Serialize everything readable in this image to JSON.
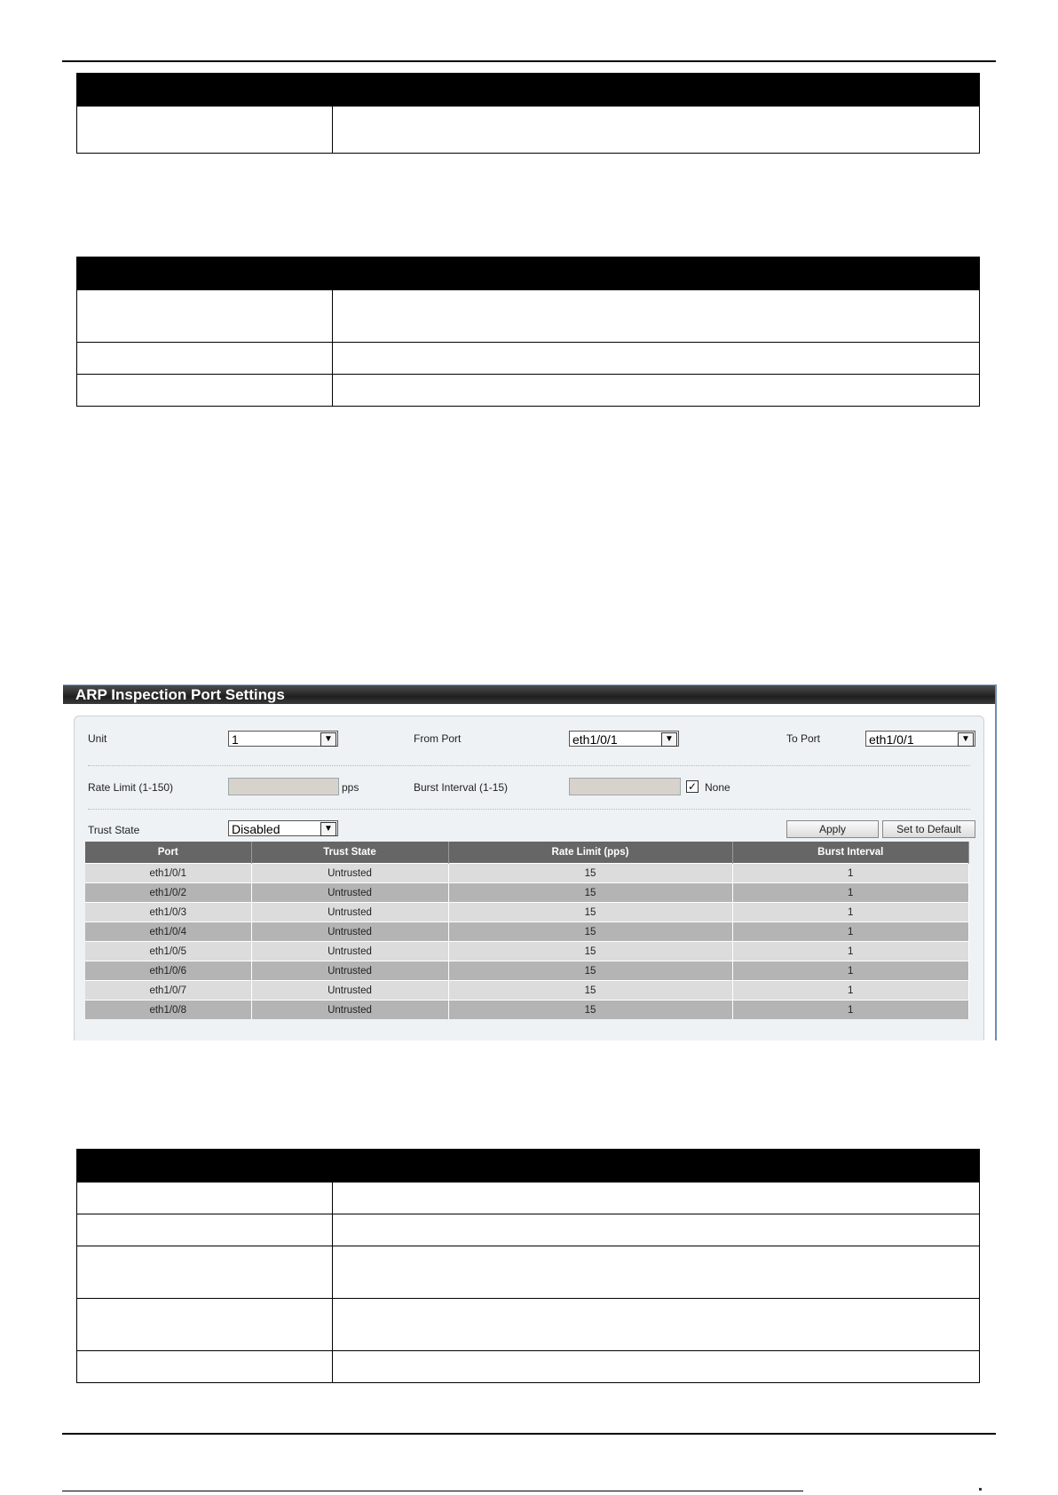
{
  "arp_panel": {
    "title": "ARP Inspection Port Settings",
    "unit_label": "Unit",
    "unit_value": "1",
    "from_port_label": "From Port",
    "from_port_value": "eth1/0/1",
    "to_port_label": "To Port",
    "to_port_value": "eth1/0/1",
    "rate_limit_label": "Rate Limit (1-150)",
    "rate_limit_unit": "pps",
    "burst_interval_label": "Burst Interval (1-15)",
    "none_label": "None",
    "none_checked": true,
    "trust_state_label": "Trust State",
    "trust_state_value": "Disabled",
    "apply_label": "Apply",
    "default_label": "Set to Default",
    "columns": [
      "Port",
      "Trust State",
      "Rate Limit (pps)",
      "Burst Interval"
    ],
    "rows": [
      [
        "eth1/0/1",
        "Untrusted",
        "15",
        "1"
      ],
      [
        "eth1/0/2",
        "Untrusted",
        "15",
        "1"
      ],
      [
        "eth1/0/3",
        "Untrusted",
        "15",
        "1"
      ],
      [
        "eth1/0/4",
        "Untrusted",
        "15",
        "1"
      ],
      [
        "eth1/0/5",
        "Untrusted",
        "15",
        "1"
      ],
      [
        "eth1/0/6",
        "Untrusted",
        "15",
        "1"
      ],
      [
        "eth1/0/7",
        "Untrusted",
        "15",
        "1"
      ],
      [
        "eth1/0/8",
        "Untrusted",
        "15",
        "1"
      ]
    ]
  }
}
